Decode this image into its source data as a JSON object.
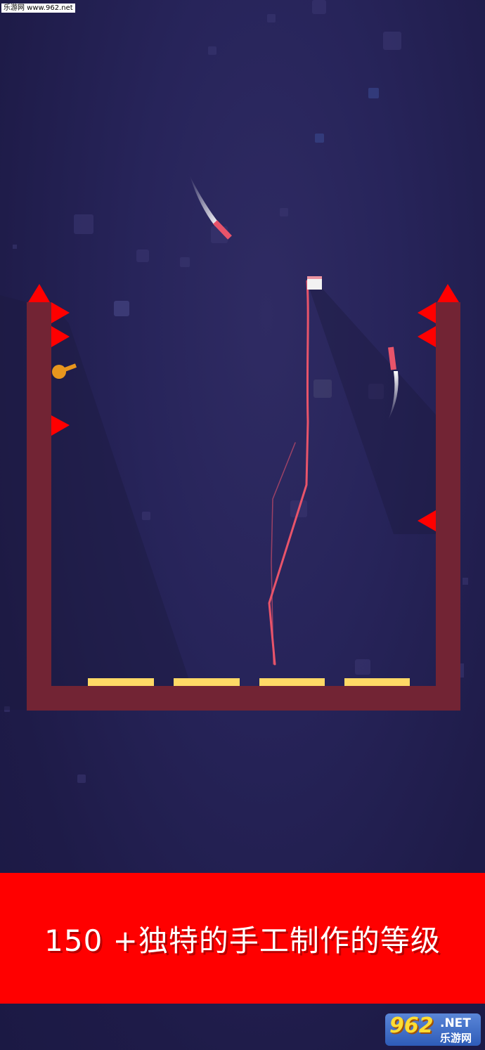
{
  "watermark": "乐游网 www.962.net",
  "banner": {
    "text": "150 +独特的手工制作的等级"
  },
  "logo": {
    "number": "962",
    "suffix": ".NET",
    "name": "乐游网"
  },
  "colors": {
    "background": "#27245a",
    "container": "#722434",
    "spike": "#ff0000",
    "target_pad": "#ffd966",
    "rope": "#e8546a",
    "banner": "#ff0000"
  },
  "game": {
    "target_pads": 4,
    "spikes_left_wall": 4,
    "spikes_right_wall": 4,
    "wall_top_spikes": 2
  }
}
